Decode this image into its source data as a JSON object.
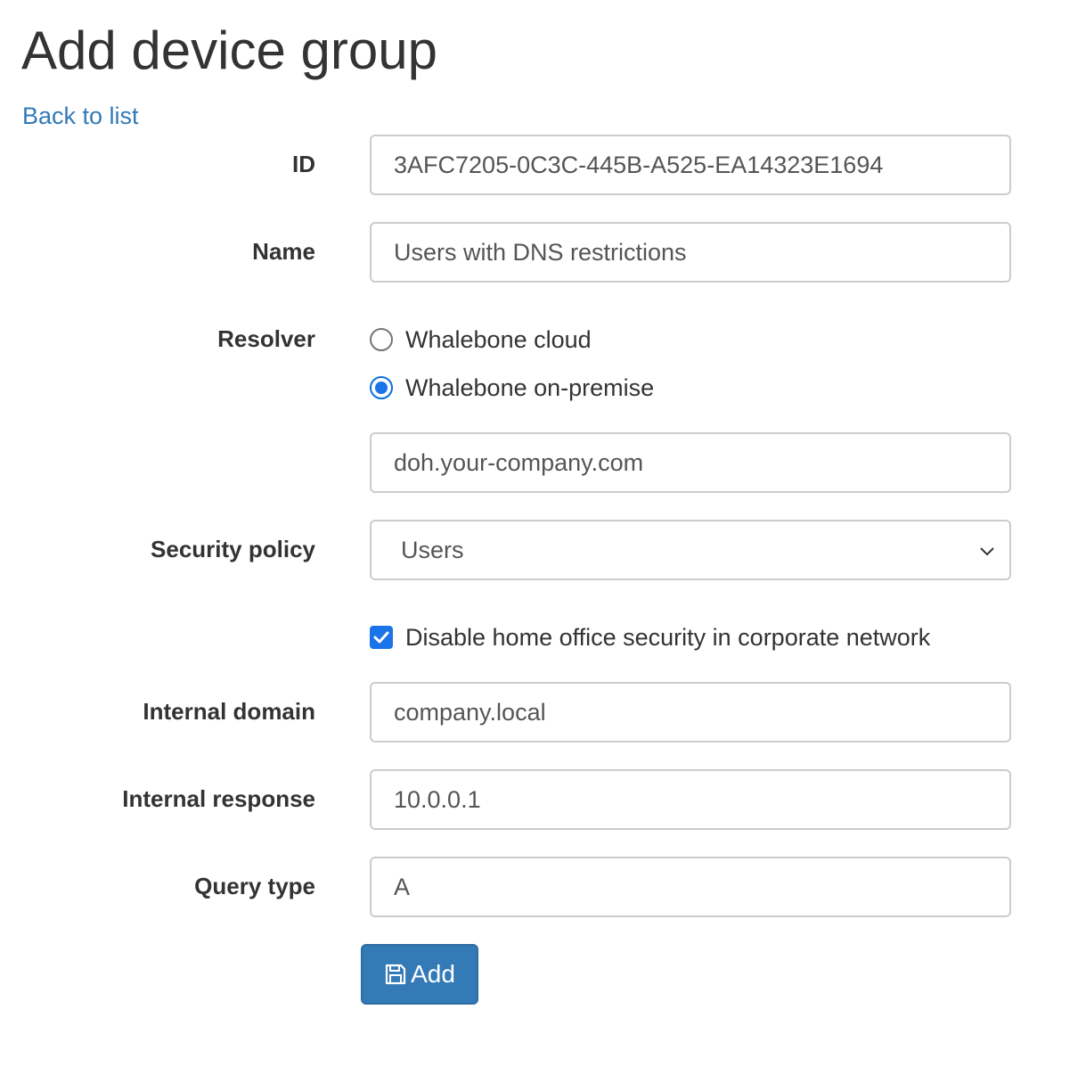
{
  "page": {
    "title": "Add device group",
    "back_link": "Back to list"
  },
  "form": {
    "id": {
      "label": "ID",
      "value": "3AFC7205-0C3C-445B-A525-EA14323E1694"
    },
    "name": {
      "label": "Name",
      "value": "Users with DNS restrictions"
    },
    "resolver": {
      "label": "Resolver",
      "options": [
        {
          "label": "Whalebone cloud",
          "checked": false
        },
        {
          "label": "Whalebone on-premise",
          "checked": true
        }
      ],
      "endpoint_value": "doh.your-company.com"
    },
    "security_policy": {
      "label": "Security policy",
      "selected": "Users"
    },
    "home_office": {
      "label": "Disable home office security in corporate network",
      "checked": true
    },
    "internal_domain": {
      "label": "Internal domain",
      "value": "company.local"
    },
    "internal_response": {
      "label": "Internal response",
      "value": "10.0.0.1"
    },
    "query_type": {
      "label": "Query type",
      "value": "A"
    },
    "submit": {
      "label": "Add",
      "icon": "save-icon"
    }
  },
  "colors": {
    "link": "#337ab7",
    "primary_button": "#337ab7",
    "control_accent": "#1a73e8",
    "border": "#cccccc"
  }
}
